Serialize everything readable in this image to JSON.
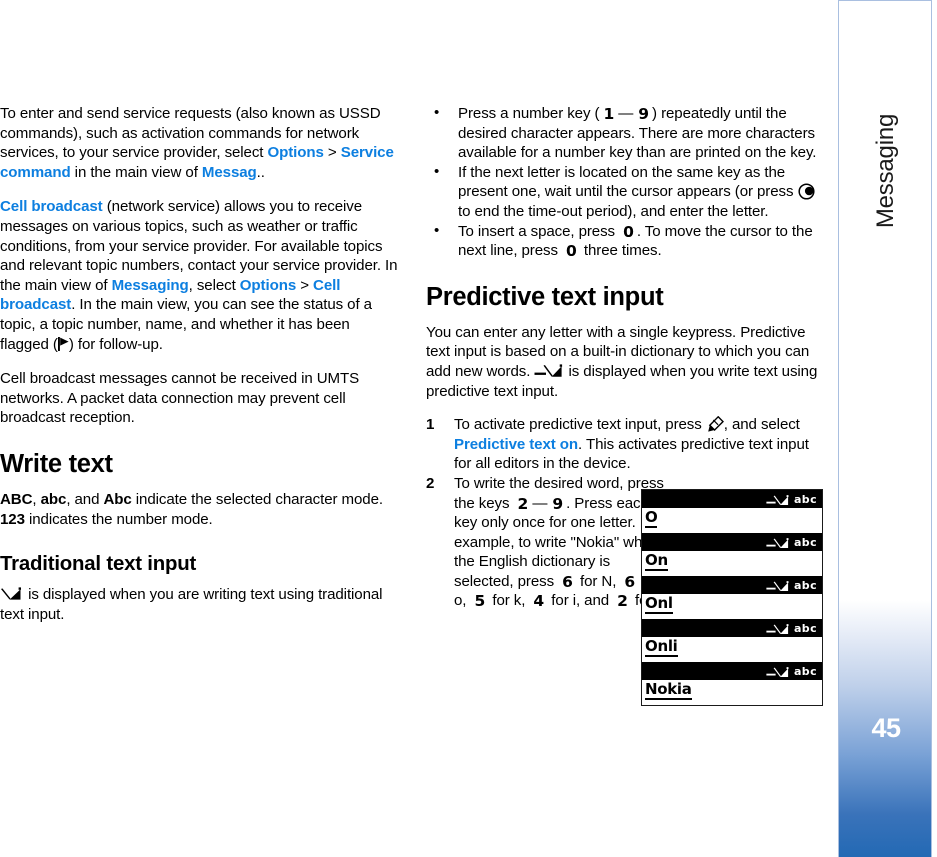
{
  "sidebar": {
    "chapter_title": "Messaging",
    "page_number": "45"
  },
  "left_column": {
    "para_ussd": {
      "t1": "To enter and send service requests (also known as USSD commands), such as activation commands for network services, to your service provider, select ",
      "link_options": "Options",
      "sep": " > ",
      "link_service_command": "Service command",
      "t2": " in the main view of ",
      "link_messag": "Messag",
      "t3": ".."
    },
    "para_cellbroadcast": {
      "link_cell_broadcast": "Cell broadcast",
      "t1": " (network service) allows you to receive messages on various topics, such as weather or traffic conditions, from your service provider. For available topics and relevant topic numbers, contact your service provider. In the main view of ",
      "link_messaging": "Messaging",
      "t2": ", select ",
      "link_options": "Options",
      "sep": " > ",
      "link_cell_broadcast_2": "Cell broadcast",
      "t3": ". In the main view, you can see the status of a topic, a topic number, name, and whether it has been flagged (",
      "t4": ") for follow-up."
    },
    "para_umts": "Cell broadcast messages cannot be received in UMTS networks. A packet data connection may prevent cell broadcast reception.",
    "heading_write_text": "Write text",
    "para_modes": {
      "abc_upper": "ABC",
      "c1": ", ",
      "abc_lower": "abc",
      "c2": ", and ",
      "abc_mixed": "Abc",
      "t1": " indicate the selected character mode. ",
      "num_mode": "123",
      "t2": " indicates the number mode."
    },
    "heading_traditional": "Traditional text input",
    "para_traditional": " is displayed when you are writing text using traditional text input."
  },
  "right_column": {
    "bullets": [
      {
        "t1": "Press a number key (",
        "key_a": "1",
        "dash": "—",
        "key_b": "9",
        "t2": ") repeatedly until the desired character appears. There are more characters available for a number key than are printed on the key."
      },
      {
        "t1": "If the next letter is located on the same key as the present one, wait until the cursor appears (or press ",
        "t2": " to end the time-out period), and enter the letter."
      },
      {
        "t1": "To insert a space, press ",
        "key_a": "0",
        "t2": ". To move the cursor to the next line, press ",
        "key_b": "0",
        "t3": " three times."
      }
    ],
    "heading_predictive": "Predictive text input",
    "para_predictive": {
      "t1": "You can enter any letter with a single keypress. Predictive text input is based on a built-in dictionary to which you can add new words. ",
      "t2": " is displayed when you write text using predictive text input."
    },
    "steps": [
      {
        "num": "1",
        "t1": "To activate predictive text input, press ",
        "t2": ", and select ",
        "link": "Predictive text on",
        "t3": ". This activates predictive text input for all editors in the device."
      },
      {
        "num": "2",
        "t1": "To write the desired word, press the keys ",
        "key_a": "2",
        "dash": "—",
        "key_b": "9",
        "t2": ". Press each key only once for one letter. For example, to write \"Nokia\" when the English dictionary is selected, press ",
        "key_c": "6",
        "t3": " for N, ",
        "key_d": "6",
        "t4": " for o, ",
        "key_e": "5",
        "t5": " for k, ",
        "key_f": "4",
        "t6": " for i, and ",
        "key_g": "2",
        "t7": " for a."
      }
    ]
  },
  "phone_screen": {
    "rows": [
      {
        "mode": "abc",
        "text": "O"
      },
      {
        "mode": "abc",
        "text": "On"
      },
      {
        "mode": "abc",
        "text": "Onl"
      },
      {
        "mode": "abc",
        "text": "Onli"
      },
      {
        "mode": "abc",
        "text": "Nokia"
      }
    ]
  },
  "colors": {
    "link_blue": "#0d7fe0",
    "tab_blue": "#2369b4",
    "tab_border": "#a9bfe0"
  }
}
